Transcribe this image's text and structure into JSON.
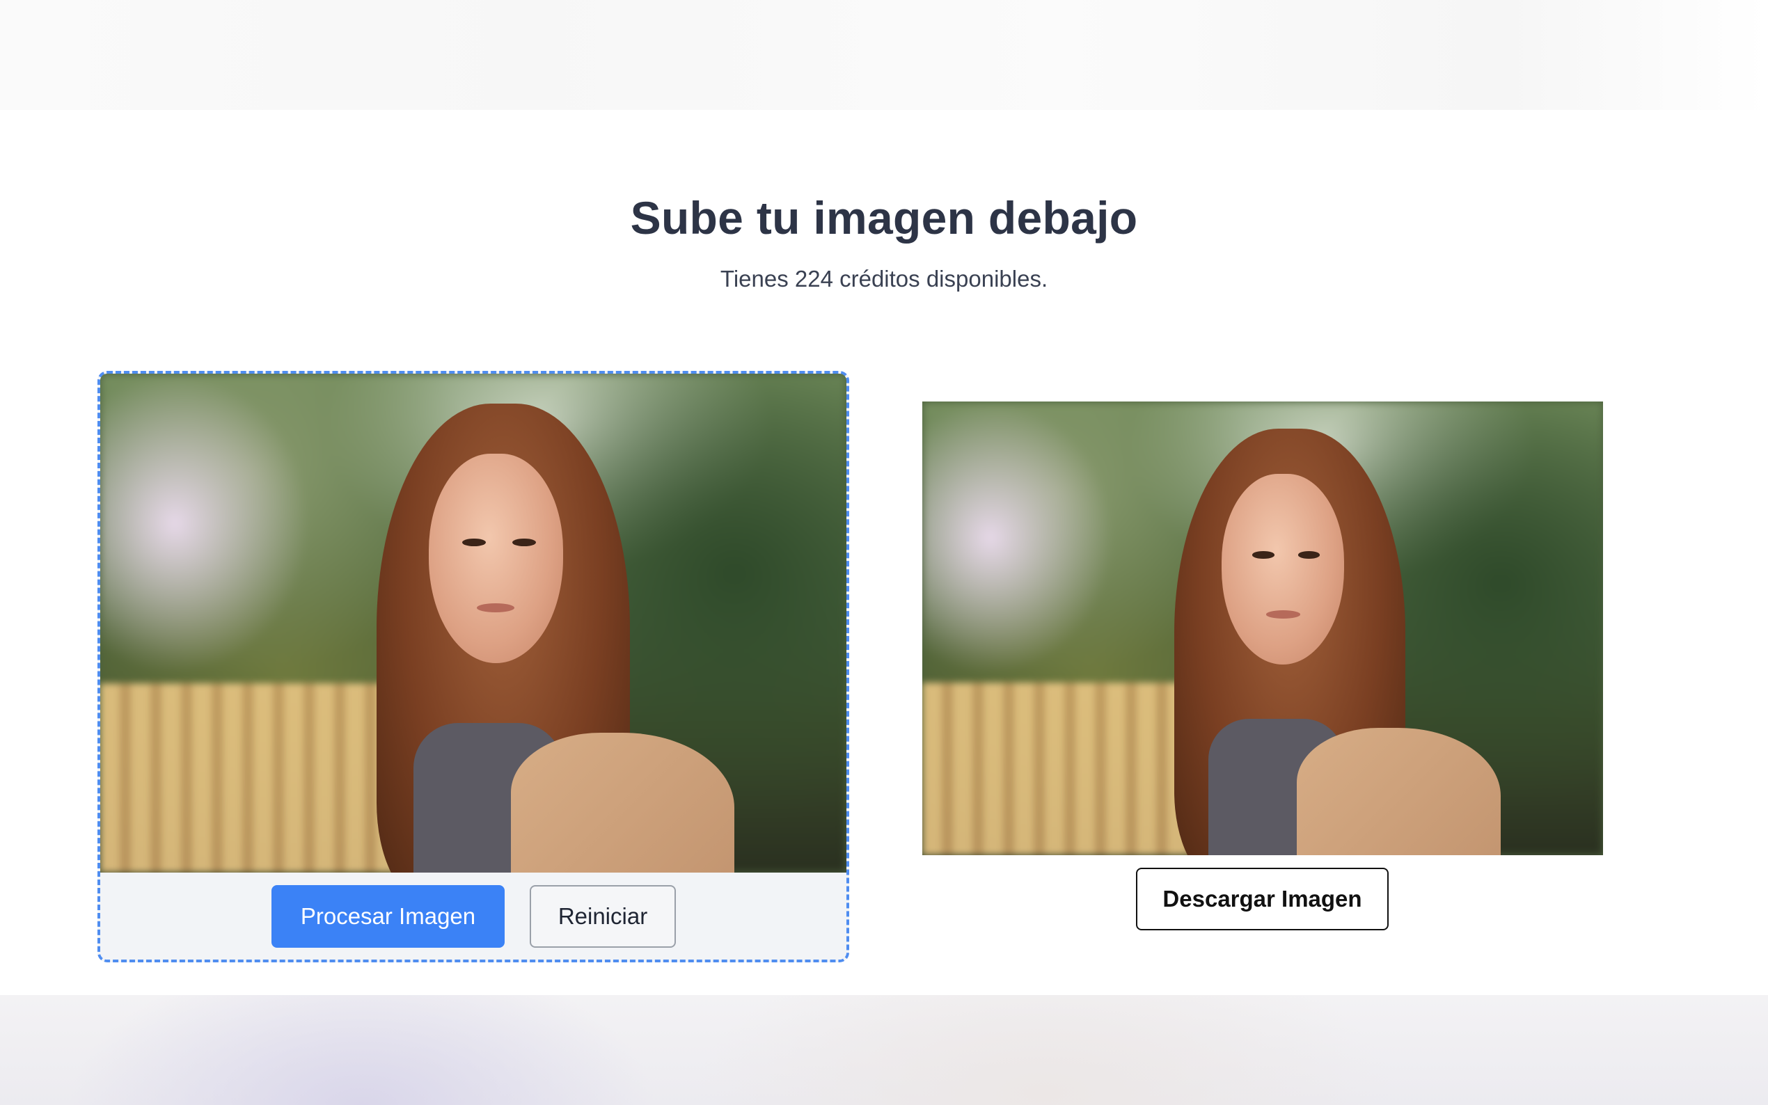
{
  "page": {
    "heading": "Sube tu imagen debajo",
    "subheading": "Tienes 224 créditos disponibles."
  },
  "upload": {
    "process_button": "Procesar Imagen",
    "reset_button": "Reiniciar"
  },
  "result": {
    "download_button": "Descargar Imagen"
  },
  "colors": {
    "accent": "#3b82f6",
    "dashed_border": "#4f8df0",
    "heading_text": "#2d3446"
  },
  "images": {
    "original": "photo of a woman with long brown hair in a beige coat, blurred green trees in background",
    "processed": "enhanced version of the same photo of the woman"
  }
}
